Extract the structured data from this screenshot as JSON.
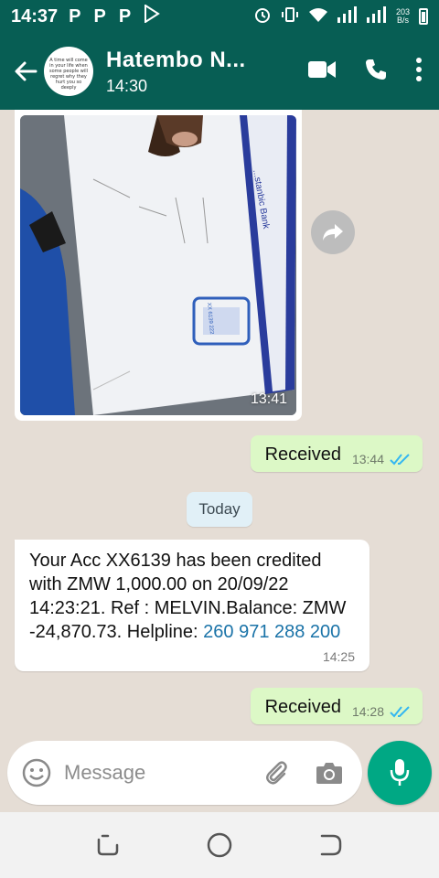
{
  "status_bar": {
    "time": "14:37",
    "p_icons": [
      "P",
      "P",
      "P"
    ],
    "speed_value": "203",
    "speed_unit": "B/s"
  },
  "header": {
    "contact_name": "Hatembo N...",
    "status": "14:30",
    "avatar_text": "A time will come in your life when some people will regret why they hurt you so deeply"
  },
  "messages": {
    "image_time": "13:41",
    "photo_bank_text": "...stanbic Bank",
    "photo_stamp": "XX 6139 222",
    "out1": {
      "text": "Received",
      "time": "13:44"
    },
    "date_divider": "Today",
    "in1": {
      "text": "Your Acc XX6139 has been credited with ZMW 1,000.00 on 20/09/22 14:23:21. Ref : MELVIN.Balance: ZMW -24,870.73. Helpline: ",
      "phone": "260 971 288 200",
      "time": "14:25"
    },
    "out2": {
      "text": "Received",
      "time": "14:28"
    }
  },
  "input": {
    "placeholder": "Message"
  },
  "icons": {
    "back": "back-arrow-icon",
    "video": "video-call-icon",
    "call": "phone-icon",
    "menu": "more-vert-icon",
    "emoji": "emoji-icon",
    "attach": "paperclip-icon",
    "camera": "camera-icon",
    "mic": "mic-icon",
    "forward": "forward-icon"
  },
  "colors": {
    "header_green": "#075e54",
    "outgoing_bubble": "#dcf8c6",
    "chat_bg": "#e5ddd5",
    "mic_button": "#00a884",
    "read_ticks": "#34b7f1",
    "link_blue": "#1a73a8"
  }
}
